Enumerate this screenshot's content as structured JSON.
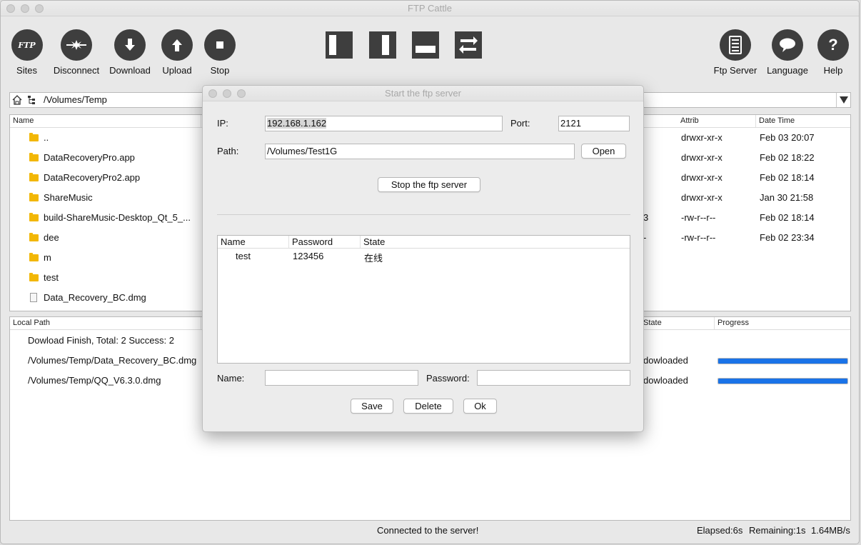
{
  "window": {
    "title": "FTP Cattle"
  },
  "toolbar": {
    "sites_label": "Sites",
    "sites_glyph": "FTP",
    "disconnect_label": "Disconnect",
    "download_label": "Download",
    "upload_label": "Upload",
    "stop_label": "Stop",
    "ftpserver_label": "Ftp Server",
    "language_label": "Language",
    "help_label": "Help",
    "help_glyph": "?"
  },
  "pathbar": {
    "path": "/Volumes/Temp"
  },
  "file_list": {
    "columns": {
      "name": "Name",
      "attrib": "Attrib",
      "datetime": "Date Time"
    },
    "rows": [
      {
        "name": "..",
        "type": "folder",
        "attrib": "drwxr-xr-x",
        "datetime": "Feb 03 20:07"
      },
      {
        "name": "DataRecoveryPro.app",
        "type": "folder",
        "attrib": "drwxr-xr-x",
        "datetime": "Feb 02 18:22"
      },
      {
        "name": "DataRecoveryPro2.app",
        "type": "folder",
        "attrib": "drwxr-xr-x",
        "datetime": "Feb 02 18:14"
      },
      {
        "name": "ShareMusic",
        "type": "folder",
        "attrib": "drwxr-xr-x",
        "datetime": "Jan 30 21:58"
      },
      {
        "name": "build-ShareMusic-Desktop_Qt_5_...",
        "type": "folder",
        "attrib": "-rw-r--r--",
        "datetime": "Feb 02 18:14",
        "fragment": "3"
      },
      {
        "name": "dee",
        "type": "folder",
        "attrib": "-rw-r--r--",
        "datetime": "Feb 02 23:34",
        "fragment": "-"
      },
      {
        "name": "m",
        "type": "folder"
      },
      {
        "name": "test",
        "type": "folder"
      },
      {
        "name": "Data_Recovery_BC.dmg",
        "type": "file"
      }
    ]
  },
  "transfer_list": {
    "columns": {
      "local_path": "Local Path",
      "state": "State",
      "progress": "Progress"
    },
    "summary": "Dowload Finish, Total: 2 Success: 2",
    "rows": [
      {
        "path": "/Volumes/Temp/Data_Recovery_BC.dmg",
        "state": "dowloaded",
        "progress": 1.0
      },
      {
        "path": "/Volumes/Temp/QQ_V6.3.0.dmg",
        "state": "dowloaded",
        "progress": 1.0
      }
    ]
  },
  "statusbar": {
    "message": "Connected to the server!",
    "elapsed": "Elapsed:6s",
    "remaining": "Remaining:1s",
    "speed": "1.64MB/s"
  },
  "dialog": {
    "title": "Start the ftp server",
    "ip_label": "IP:",
    "ip_value": "192.168.1.162",
    "port_label": "Port:",
    "port_value": "2121",
    "path_label": "Path:",
    "path_value": "/Volumes/Test1G",
    "open_label": "Open",
    "stop_server_label": "Stop the ftp server",
    "users": {
      "columns": {
        "name": "Name",
        "password": "Password",
        "state": "State"
      },
      "rows": [
        {
          "name": "test",
          "password": "123456",
          "state": "在线"
        }
      ]
    },
    "name_label": "Name:",
    "name_value": "",
    "password_label": "Password:",
    "password_value": "",
    "save_label": "Save",
    "delete_label": "Delete",
    "ok_label": "Ok"
  },
  "colors": {
    "progress": "#1a73e8",
    "icon_dark": "#3e3e3e",
    "folder": "#f2b705"
  }
}
